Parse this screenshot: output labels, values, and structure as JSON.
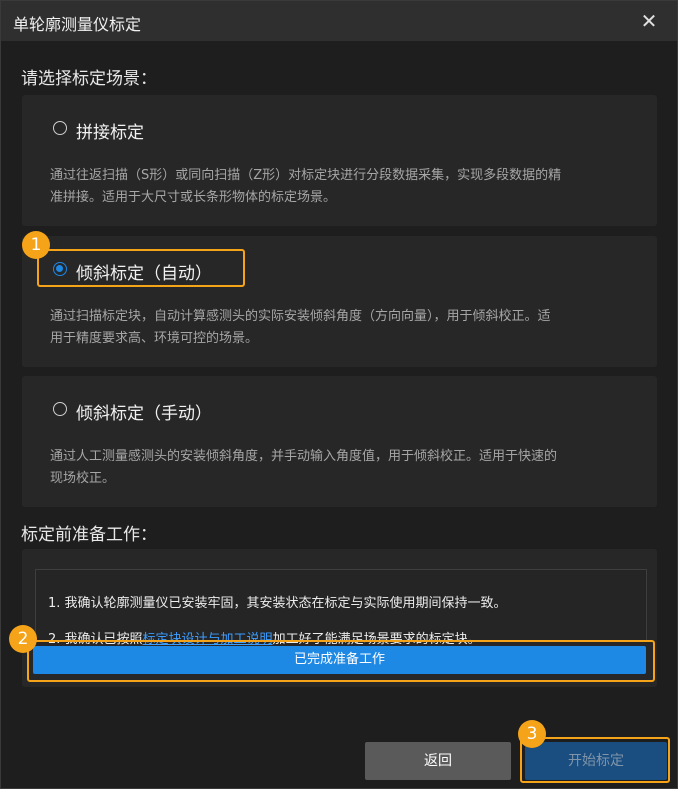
{
  "window": {
    "title": "单轮廓测量仪标定",
    "close_glyph": "✕"
  },
  "scene": {
    "heading": "请选择标定场景：",
    "options": [
      {
        "label": "拼接标定",
        "selected": false,
        "desc_1": "通过往返扫描（S形）或同向扫描（Z形）对标定块进行分段数据采集，实现多段数据的精",
        "desc_2": "准拼接。适用于大尺寸或长条形物体的标定场景。"
      },
      {
        "label": "倾斜标定（自动）",
        "selected": true,
        "desc_1": "通过扫描标定块，自动计算感测头的实际安装倾斜角度（方向向量），用于倾斜校正。适",
        "desc_2": "用于精度要求高、环境可控的场景。"
      },
      {
        "label": "倾斜标定（手动）",
        "selected": false,
        "desc_1": "通过人工测量感测头的安装倾斜角度，并手动输入角度值，用于倾斜校正。适用于快速的",
        "desc_2": "现场校正。"
      }
    ]
  },
  "prep": {
    "heading": "标定前准备工作：",
    "line1": "1. 我确认轮廓测量仪已安装牢固，其安装状态在标定与实际使用期间保持一致。",
    "line2_prefix": "2. 我确认已按照",
    "line2_link": "标定块设计与加工说明",
    "line2_suffix": "加工好了能满足场景要求的标定块。",
    "ready_button": "已完成准备工作"
  },
  "footer": {
    "back_button": "返回",
    "start_button": "开始标定"
  },
  "callouts": [
    "1",
    "2",
    "3"
  ],
  "colors": {
    "accent": "#1e88e5",
    "callout": "#f5a318",
    "link": "#3b9dff",
    "start_disabled": "#1a4d80"
  }
}
